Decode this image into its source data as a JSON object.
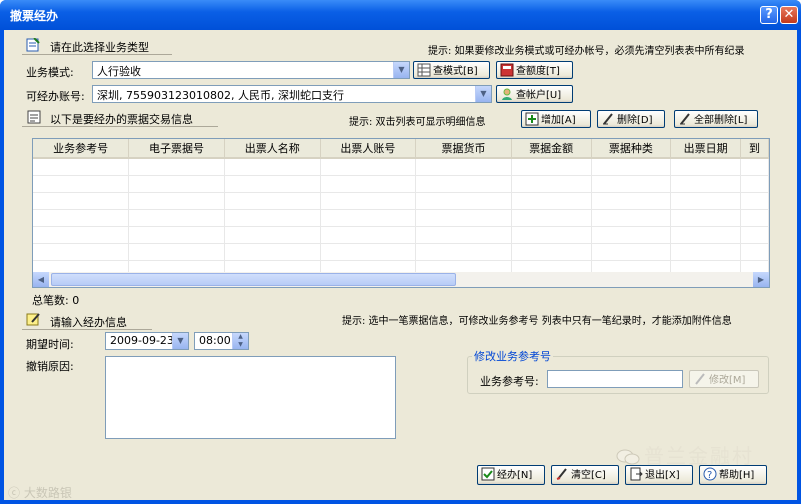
{
  "window": {
    "title": "撤票经办",
    "help_label": "?",
    "close_label": "✕"
  },
  "business": {
    "section_title": "请在此选择业务类型",
    "hint": "提示: 如果要修改业务模式或可经办帐号，必须先清空列表表中所有纪录",
    "mode_label": "业务模式:",
    "mode_value": "人行验收",
    "btn_check_mode": "查模式[B]",
    "btn_check_amount": "查额度[T]",
    "account_label": "可经办账号:",
    "account_value": "深圳, 755903123010802, 人民币, 深圳蛇口支行",
    "btn_check_account": "查帐户[U]"
  },
  "transactions": {
    "section_title": "以下是要经办的票据交易信息",
    "hint": "提示: 双击列表可显示明细信息",
    "btn_add": "增加[A]",
    "btn_delete": "删除[D]",
    "btn_delete_all": "全部删除[L]",
    "columns": [
      "业务参考号",
      "电子票据号",
      "出票人名称",
      "出票人账号",
      "票据货币",
      "票据金额",
      "票据种类",
      "出票日期",
      "到"
    ],
    "total_label": "总笔数: 0"
  },
  "handling": {
    "section_title": "请输入经办信息",
    "hint": "提示: 选中一笔票据信息，可修改业务参考号 列表中只有一笔纪录时，才能添加附件信息",
    "expected_time_label": "期望时间:",
    "date_value": "2009-09-23",
    "time_value": "08:00",
    "reason_label": "撤销原因:",
    "reason_value": "",
    "modify_group_title": "修改业务参考号",
    "ref_label": "业务参考号:",
    "ref_value": "",
    "btn_modify": "修改[M]"
  },
  "footer": {
    "btn_handle": "经办[N]",
    "btn_clear": "清空[C]",
    "btn_exit": "退出[X]",
    "btn_help": "帮助[H]"
  },
  "watermarks": {
    "right": "普兰金融村",
    "left": "大数路银"
  }
}
